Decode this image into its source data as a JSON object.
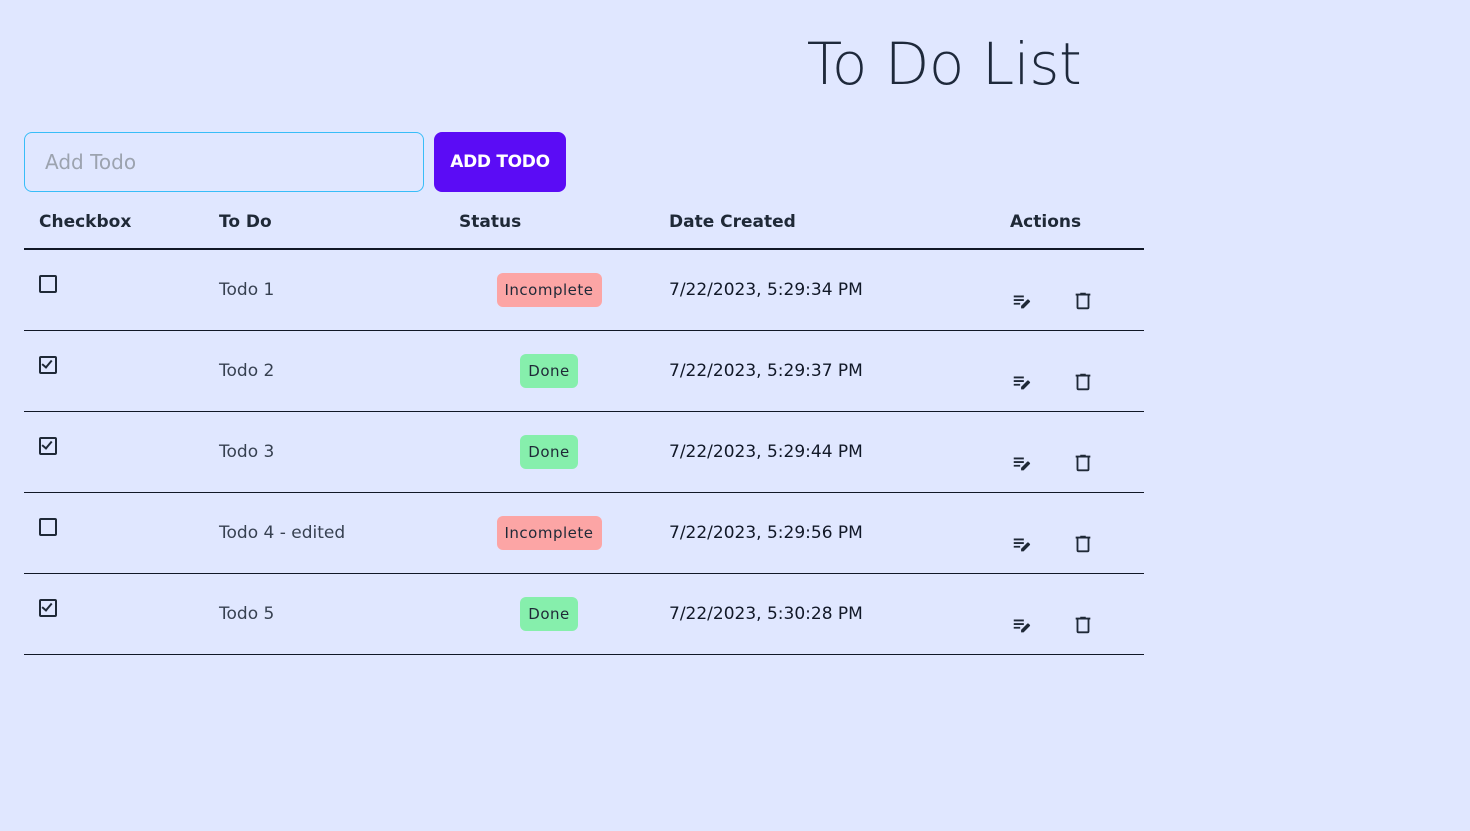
{
  "page": {
    "title": "To Do List"
  },
  "add_form": {
    "placeholder": "Add Todo",
    "value": "",
    "button_label": "ADD TODO"
  },
  "table": {
    "headers": {
      "checkbox": "Checkbox",
      "todo": "To Do",
      "status": "Status",
      "date": "Date Created",
      "actions": "Actions"
    },
    "rows": [
      {
        "checked": false,
        "text": "Todo 1",
        "status": "Incomplete",
        "date": "7/22/2023, 5:29:34 PM"
      },
      {
        "checked": true,
        "text": "Todo 2",
        "status": "Done",
        "date": "7/22/2023, 5:29:37 PM"
      },
      {
        "checked": true,
        "text": "Todo 3",
        "status": "Done",
        "date": "7/22/2023, 5:29:44 PM"
      },
      {
        "checked": false,
        "text": "Todo 4 - edited",
        "status": "Incomplete",
        "date": "7/22/2023, 5:29:56 PM"
      },
      {
        "checked": true,
        "text": "Todo 5",
        "status": "Done",
        "date": "7/22/2023, 5:30:28 PM"
      }
    ]
  },
  "icons": {
    "edit": "edit-note-icon",
    "delete": "trash-icon"
  },
  "colors": {
    "background": "#e0e7ff",
    "accent": "#5b0cf5",
    "incomplete": "#fca5a5",
    "done": "#86efac"
  }
}
